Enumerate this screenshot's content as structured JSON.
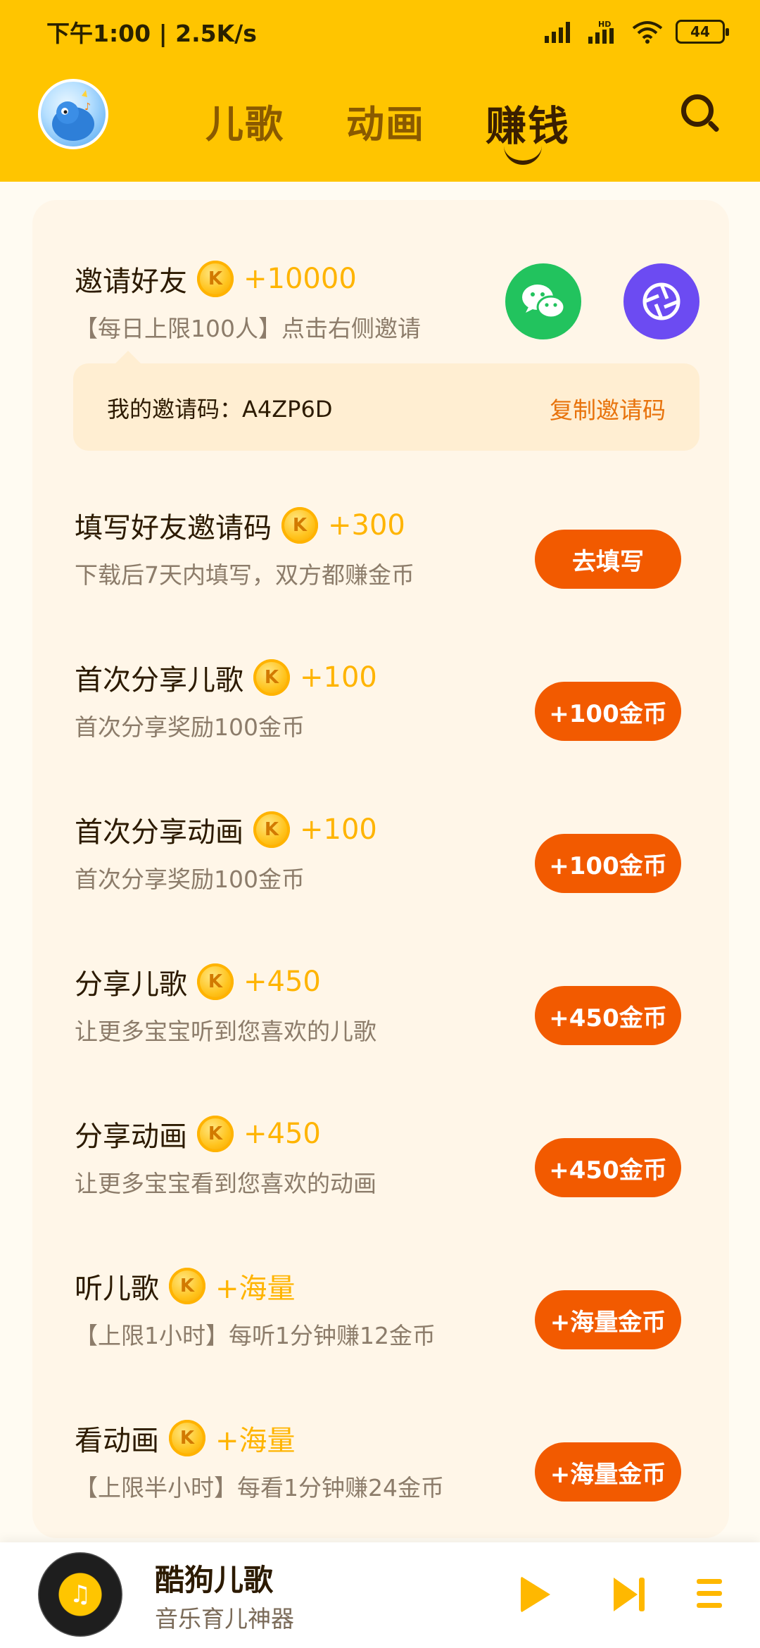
{
  "status_bar": {
    "time": "下午1:00 | 2.5K/s",
    "battery": "44"
  },
  "tabs": [
    {
      "label": "儿歌"
    },
    {
      "label": "动画"
    },
    {
      "label": "赚钱"
    }
  ],
  "invite": {
    "title": "邀请好友",
    "reward": "+10000",
    "desc": "【每日上限100人】点击右侧邀请",
    "code_label": "我的邀请码：A4ZP6D",
    "copy_label": "复制邀请码"
  },
  "tasks": [
    {
      "title": "填写好友邀请码",
      "reward": "+300",
      "desc": "下载后7天内填写，双方都赚金币",
      "button": "去填写"
    },
    {
      "title": "首次分享儿歌",
      "reward": "+100",
      "desc": "首次分享奖励100金币",
      "button": "+100金币"
    },
    {
      "title": "首次分享动画",
      "reward": "+100",
      "desc": "首次分享奖励100金币",
      "button": "+100金币"
    },
    {
      "title": "分享儿歌",
      "reward": "+450",
      "desc": "让更多宝宝听到您喜欢的儿歌",
      "button": "+450金币"
    },
    {
      "title": "分享动画",
      "reward": "+450",
      "desc": "让更多宝宝看到您喜欢的动画",
      "button": "+450金币"
    },
    {
      "title": "听儿歌",
      "reward": "+海量",
      "desc": "【上限1小时】每听1分钟赚12金币",
      "button": "+海量金币"
    },
    {
      "title": "看动画",
      "reward": "+海量",
      "desc": "【上限半小时】每看1分钟赚24金币",
      "button": "+海量金币"
    }
  ],
  "coin_symbol": "K",
  "player": {
    "title": "酷狗儿歌",
    "subtitle": "音乐育儿神器",
    "disc_glyph": "♫"
  },
  "colors": {
    "header": "#FFC500",
    "button": "#F25A00",
    "reward": "#FFB400",
    "wechat": "#22C35E",
    "share": "#6C4BF2"
  }
}
